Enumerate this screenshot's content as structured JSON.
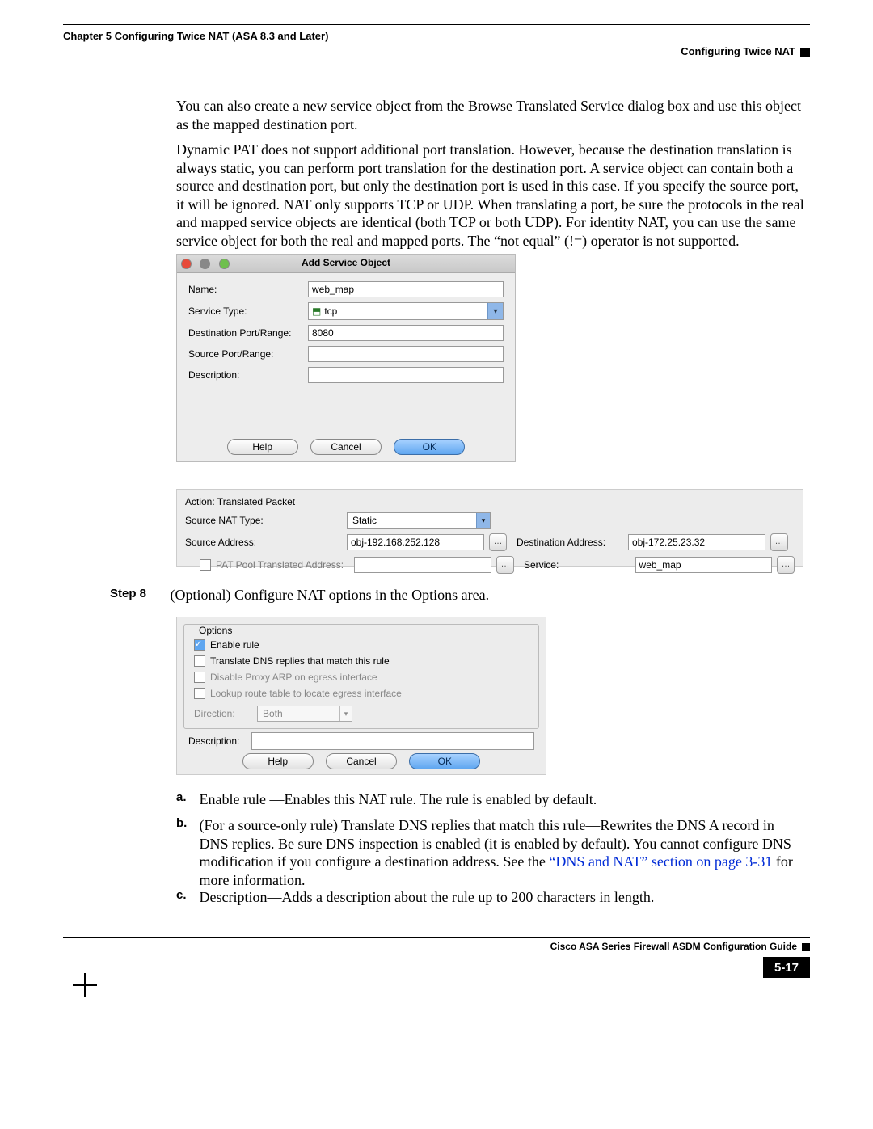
{
  "header": {
    "left": "Chapter 5    Configuring Twice NAT (ASA 8.3 and Later)",
    "right": "Configuring Twice NAT"
  },
  "para1": "You can also create a new service object from the Browse Translated Service dialog box and use this object as the mapped destination port.",
  "para2": "Dynamic PAT does not support additional port translation. However, because the destination translation is always static, you can perform port translation for the destination port. A service object can contain both a source and destination port, but only the destination port is used in this case. If you specify the source port, it will be ignored. NAT only supports TCP or UDP. When translating a port, be sure the protocols in the real and mapped service objects are identical (both TCP or both UDP). For identity NAT, you can use the same service object for both the real and mapped ports. The “not equal” (!=) operator is not supported.",
  "dialog1": {
    "title": "Add Service Object",
    "labels": {
      "name": "Name:",
      "service_type": "Service Type:",
      "dest_port": "Destination Port/Range:",
      "src_port": "Source Port/Range:",
      "description": "Description:"
    },
    "values": {
      "name": "web_map",
      "service_type": "tcp",
      "dest_port": "8080",
      "src_port": "",
      "description": ""
    },
    "buttons": {
      "help": "Help",
      "cancel": "Cancel",
      "ok": "OK"
    }
  },
  "panel2": {
    "section": "Action: Translated Packet",
    "labels": {
      "src_nat_type": "Source NAT Type:",
      "src_addr": "Source Address:",
      "pat_pool": "PAT Pool Translated Address:",
      "dest_addr": "Destination Address:",
      "service": "Service:"
    },
    "values": {
      "src_nat_type": "Static",
      "src_addr": "obj-192.168.252.128",
      "pat_pool": "",
      "dest_addr": "obj-172.25.23.32",
      "service": "web_map"
    }
  },
  "step8": {
    "label": "Step 8",
    "text": "(Optional) Configure NAT options in the Options area."
  },
  "panel3": {
    "legend": "Options",
    "opts": {
      "enable": "Enable rule",
      "dns": "Translate DNS replies that match this rule",
      "proxy": "Disable Proxy ARP on egress interface",
      "lookup": "Lookup route table to locate egress interface"
    },
    "direction_label": "Direction:",
    "direction_value": "Both",
    "description_label": "Description:",
    "buttons": {
      "help": "Help",
      "cancel": "Cancel",
      "ok": "OK"
    }
  },
  "list": {
    "a": {
      "label": "a.",
      "text": "Enable rule —Enables this NAT rule. The rule is enabled by default."
    },
    "b": {
      "label": "b.",
      "pre": "(For a source-only rule) Translate DNS replies that match this rule—Rewrites the DNS A record in DNS replies. Be sure DNS inspection is enabled (it is enabled by default). You cannot configure DNS modification if you configure a destination address. See the ",
      "link": "“DNS and NAT” section on page 3-31",
      "post": " for more information."
    },
    "c": {
      "label": "c.",
      "text": "Description—Adds a description about the rule up to 200 characters in length."
    }
  },
  "footer": {
    "guide": "Cisco ASA Series Firewall ASDM Configuration Guide",
    "page": "5-17"
  }
}
